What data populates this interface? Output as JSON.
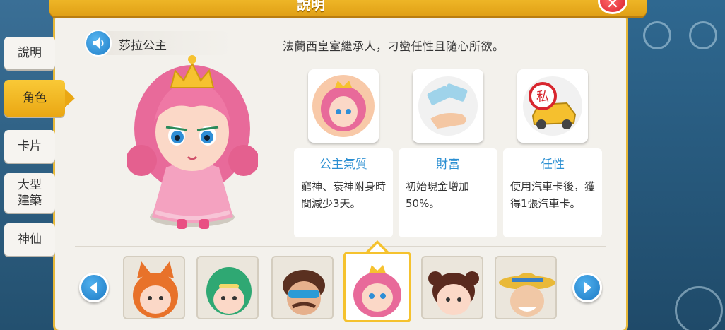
{
  "header": {
    "title": "說明",
    "close_glyph": "✕"
  },
  "tabs": [
    {
      "label": "說明",
      "active": false
    },
    {
      "label": "角色",
      "active": true
    },
    {
      "label": "卡片",
      "active": false
    },
    {
      "label": "大型\n建築",
      "active": false
    },
    {
      "label": "神仙",
      "active": false
    }
  ],
  "character": {
    "name": "莎拉公主",
    "description": "法蘭西皇室繼承人，刁蠻任性且隨心所欲。"
  },
  "traits": [
    {
      "title": "公主氣質",
      "text": "窮神、衰神附身時間減少3天。",
      "icon": "princess-portrait-icon"
    },
    {
      "title": "財富",
      "text": "初始現金增加50%。",
      "icon": "money-hand-icon"
    },
    {
      "title": "任性",
      "text": "使用汽車卡後，獲得1張汽車卡。",
      "icon": "private-car-icon"
    }
  ],
  "selector": {
    "characters": [
      {
        "icon": "fox-girl-avatar"
      },
      {
        "icon": "green-hair-avatar"
      },
      {
        "icon": "sunglasses-man-avatar"
      },
      {
        "icon": "princess-avatar",
        "selected": true
      },
      {
        "icon": "bun-girl-avatar"
      },
      {
        "icon": "old-man-hat-avatar"
      }
    ]
  },
  "colors": {
    "accent_gold": "#f5c22e",
    "title_blue": "#2b8fd2",
    "arrow_blue": "#1d7ac4"
  }
}
